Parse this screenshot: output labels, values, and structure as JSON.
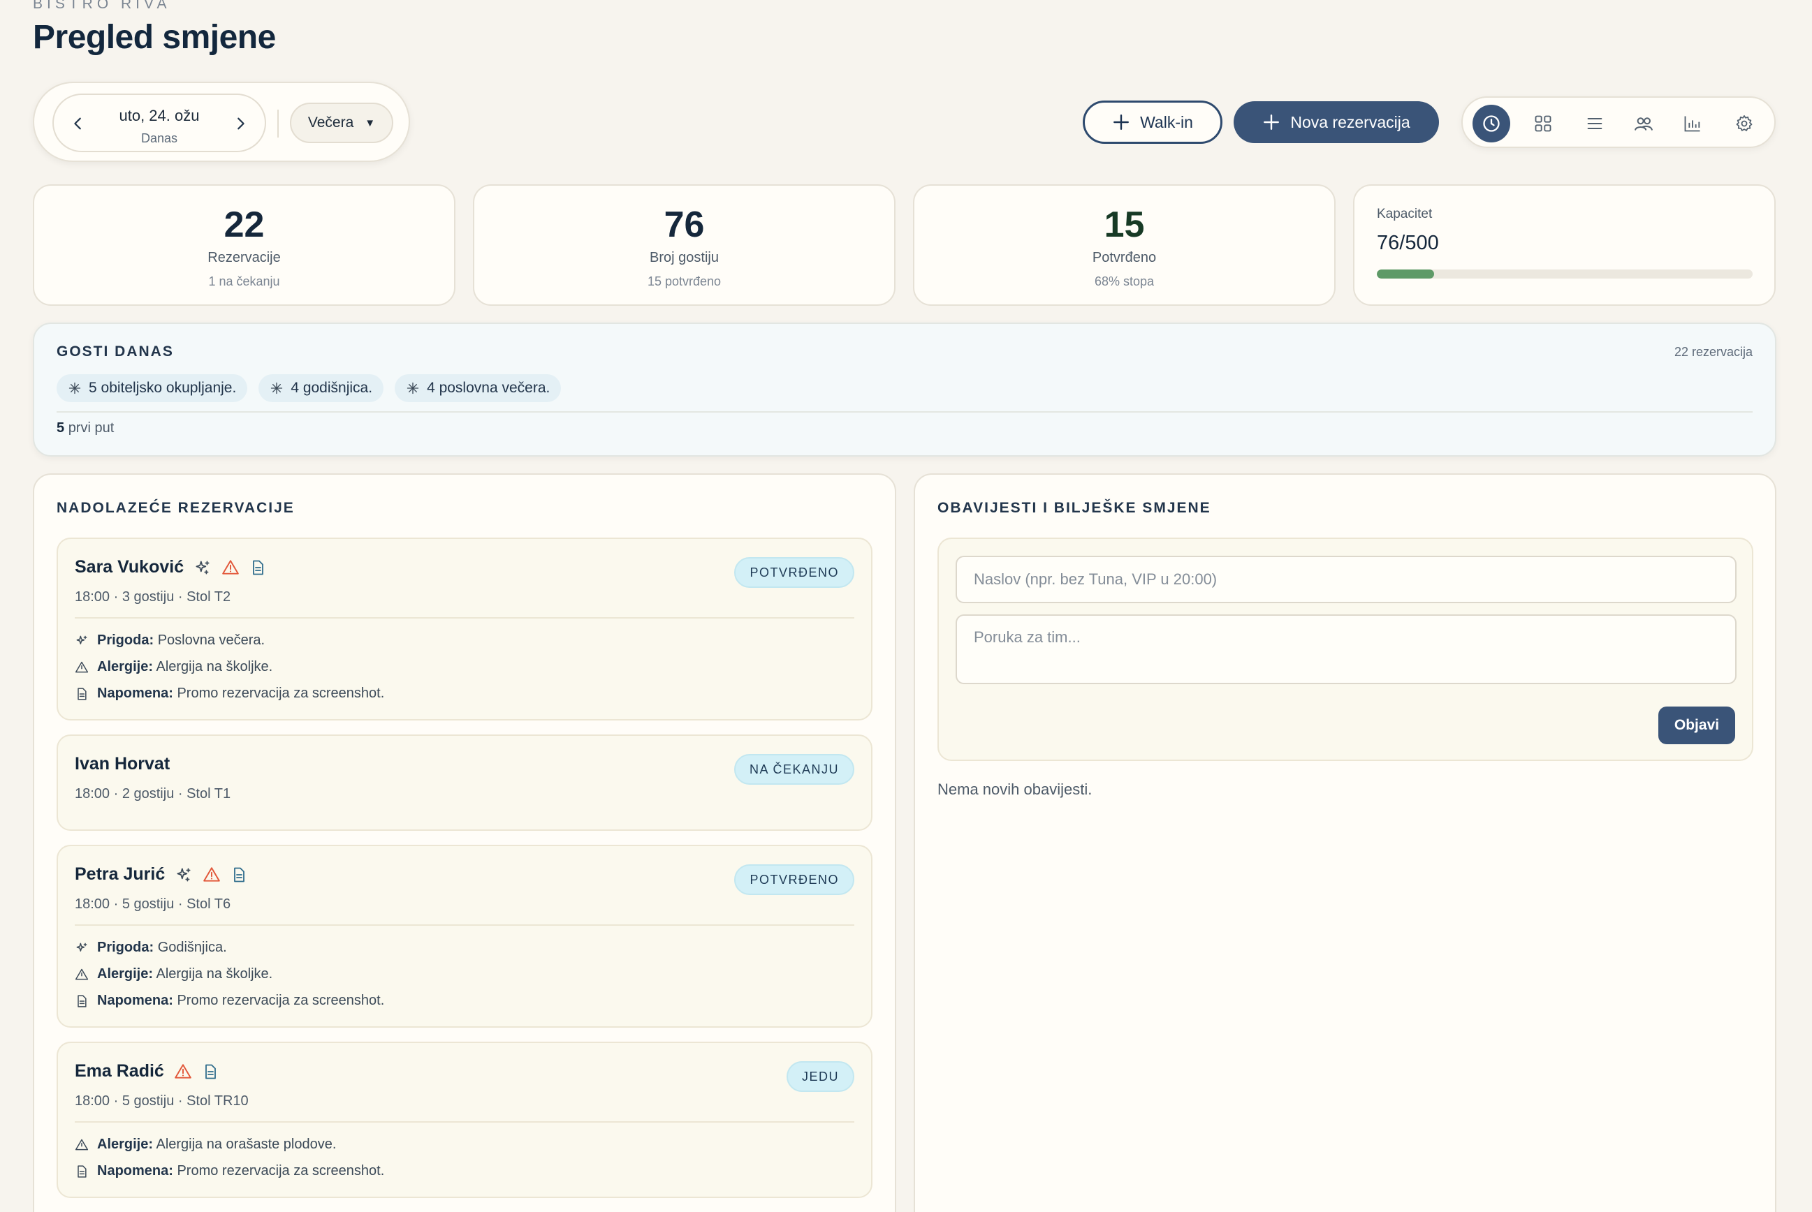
{
  "header": {
    "brand": "BISTRO RIVA",
    "title": "Pregled smjene"
  },
  "date_nav": {
    "date": "uto, 24. ožu",
    "sub": "Danas",
    "shift": "Večera"
  },
  "actions": {
    "walkin": "Walk-in",
    "new_reservation": "Nova rezervacija"
  },
  "toolbar": {
    "items": [
      "clock-icon",
      "grid-icon",
      "list-icon",
      "users-icon",
      "chart-icon",
      "gear-icon"
    ],
    "active": "clock-icon"
  },
  "stats": {
    "reservations": {
      "value": "22",
      "label": "Rezervacije",
      "sub": "1 na čekanju"
    },
    "guests": {
      "value": "76",
      "label": "Broj gostiju",
      "sub": "15 potvrđeno"
    },
    "confirmed": {
      "value": "15",
      "label": "Potvrđeno",
      "sub": "68% stopa"
    },
    "capacity": {
      "label": "Kapacitet",
      "value": "76/500",
      "fraction": 0.152
    }
  },
  "guests_today": {
    "title": "GOSTI DANAS",
    "count": "22 rezervacija",
    "chips": [
      "5 obiteljsko okupljanje.",
      "4 godišnjica.",
      "4 poslovna večera."
    ],
    "first_time_num": "5",
    "first_time_label": "prvi put"
  },
  "upcoming": {
    "title": "NADOLAZEĆE REZERVACIJE",
    "labels": {
      "occasion": "Prigoda:",
      "allergies": "Alergije:",
      "note": "Napomena:"
    },
    "items": [
      {
        "name": "Sara Vuković",
        "meta": "18:00 · 3 gostiju · Stol T2",
        "status": "POTVRĐENO",
        "occasion": "Poslovna večera.",
        "allergies": "Alergija na školjke.",
        "note": "Promo rezervacija za screenshot."
      },
      {
        "name": "Ivan Horvat",
        "meta": "18:00 · 2 gostiju · Stol T1",
        "status": "NA ČEKANJU"
      },
      {
        "name": "Petra Jurić",
        "meta": "18:00 · 5 gostiju · Stol T6",
        "status": "POTVRĐENO",
        "occasion": "Godišnjica.",
        "allergies": "Alergija na školjke.",
        "note": "Promo rezervacija za screenshot."
      },
      {
        "name": "Ema Radić",
        "meta": "18:00 · 5 gostiju · Stol TR10",
        "status": "JEDU",
        "allergies": "Alergija na orašaste plodove.",
        "note": "Promo rezervacija za screenshot."
      }
    ]
  },
  "notes": {
    "title": "OBAVIJESTI I BILJEŠKE SMJENE",
    "title_placeholder": "Naslov (npr. bez Tuna, VIP u 20:00)",
    "message_placeholder": "Poruka za tim...",
    "post": "Objavi",
    "empty": "Nema novih obavijesti."
  },
  "colors": {
    "accent": "#3a5478",
    "warning": "#e2583a",
    "note_icon": "#2f6d8c",
    "capacity_fill": "#5e9a67",
    "badge_bg": "#d3f0f7"
  }
}
